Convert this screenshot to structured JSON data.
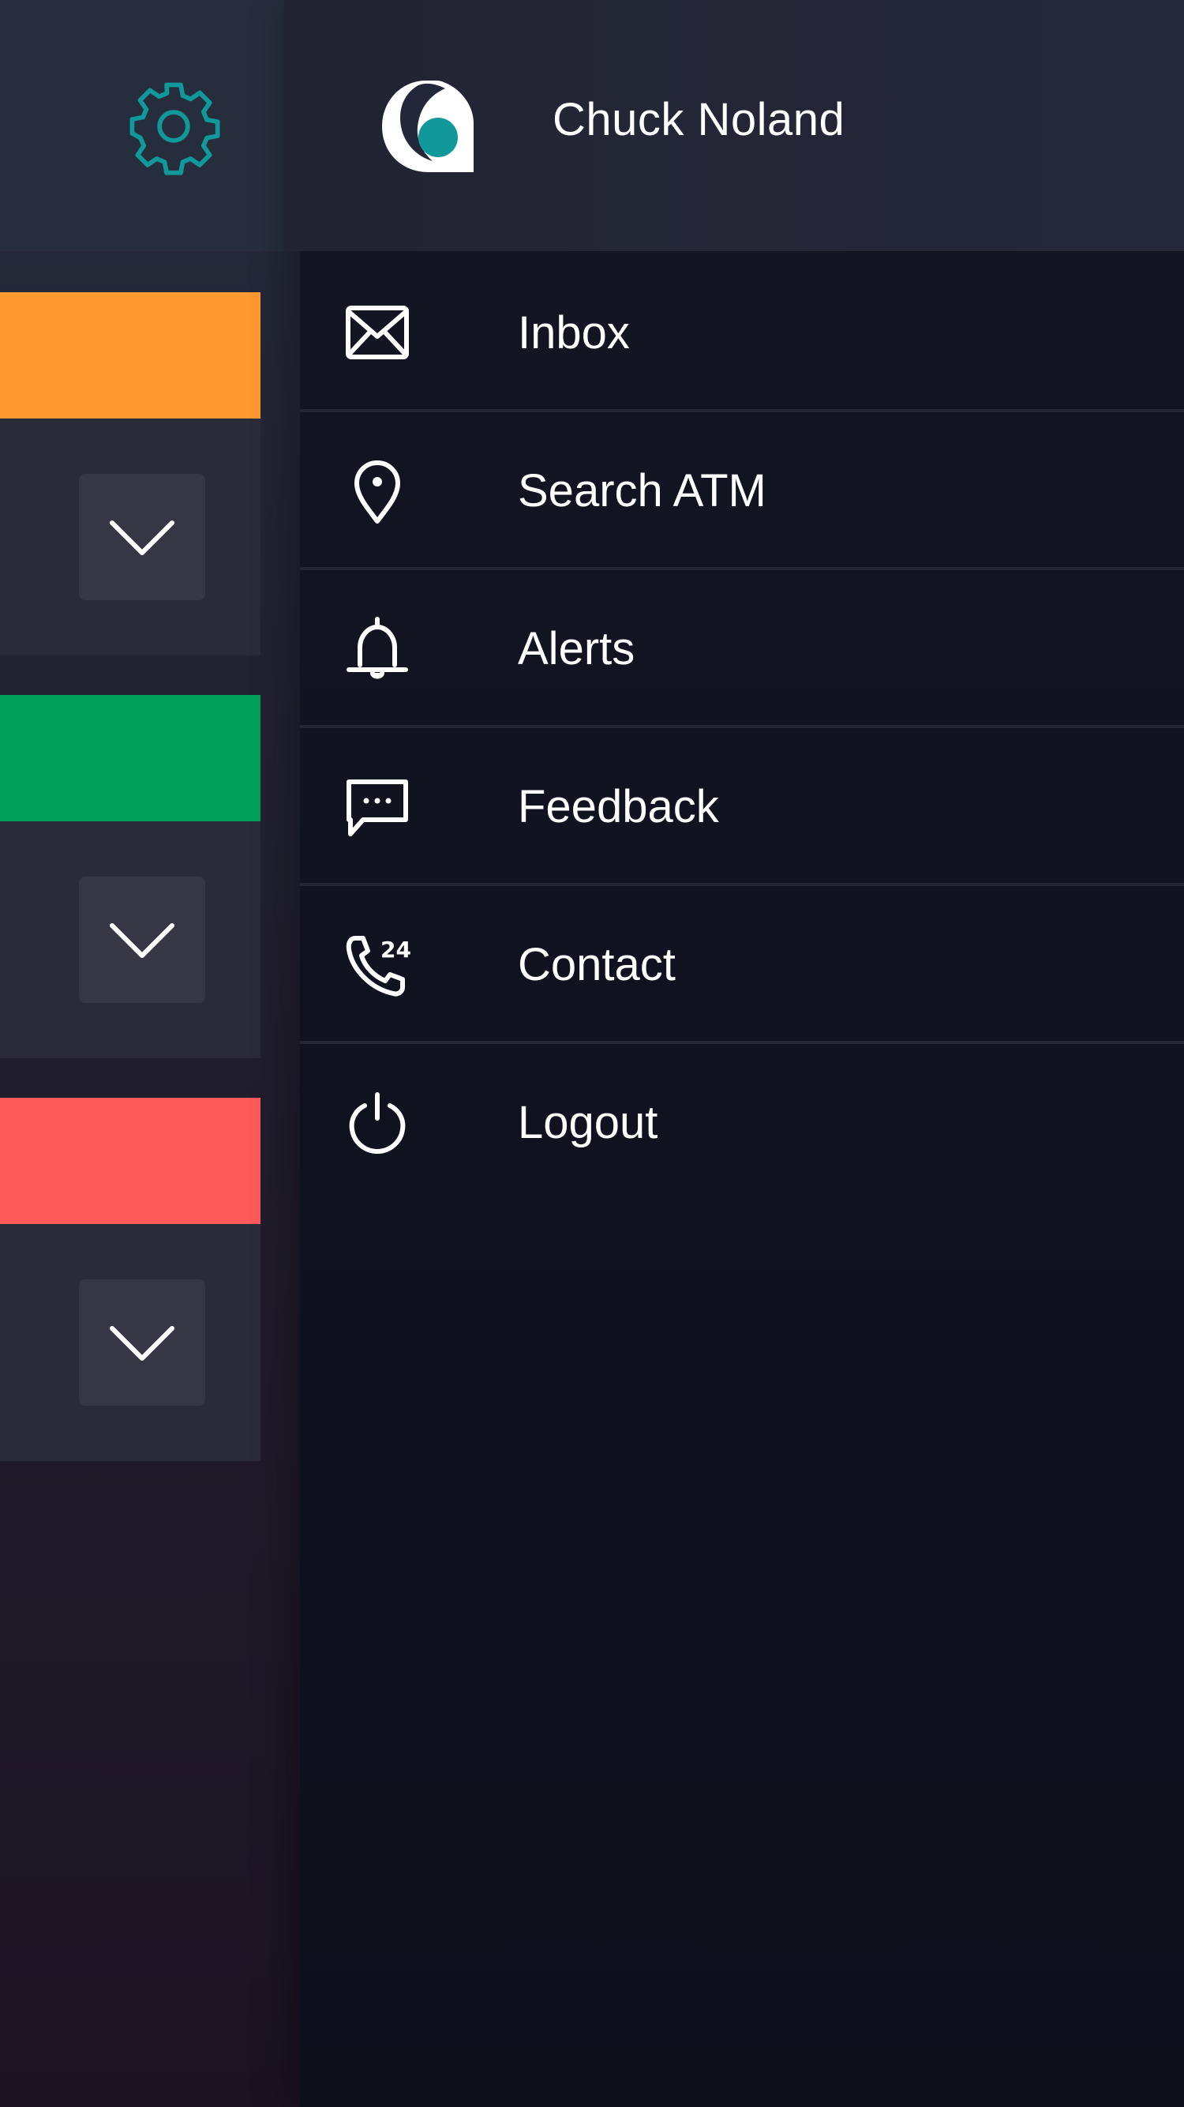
{
  "header": {
    "user_name": "Chuck Noland",
    "settings_icon": "gear-icon",
    "logo_icon": "bank-logo-icon"
  },
  "colors": {
    "accent": "#10989a",
    "card_orange": "#fe9a32",
    "card_green": "#00a05a",
    "card_red": "#fe5a5a",
    "menu_background": "#111220",
    "text": "#ffffff"
  },
  "cards": [
    {
      "color": "#fe9a32",
      "expand_icon": "chevron-down-icon"
    },
    {
      "color": "#00a05a",
      "expand_icon": "chevron-down-icon"
    },
    {
      "color": "#fe5a5a",
      "expand_icon": "chevron-down-icon"
    }
  ],
  "menu": {
    "items": [
      {
        "label": "Inbox",
        "icon": "envelope-icon"
      },
      {
        "label": "Search ATM",
        "icon": "map-pin-icon"
      },
      {
        "label": "Alerts",
        "icon": "bell-icon"
      },
      {
        "label": "Feedback",
        "icon": "chat-bubble-icon"
      },
      {
        "label": "Contact",
        "icon": "phone-24h-icon"
      },
      {
        "label": "Logout",
        "icon": "power-icon"
      }
    ]
  }
}
